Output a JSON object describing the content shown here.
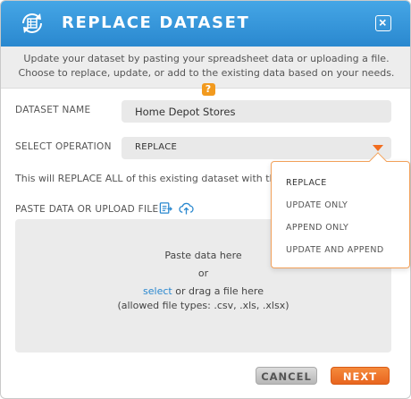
{
  "dialog": {
    "title": "REPLACE DATASET",
    "close_symbol": "✕",
    "intro_text": "Update your dataset by pasting your spreadsheet data or uploading a file. Choose to replace, update, or add to the existing data based on your needs.",
    "help_symbol": "?"
  },
  "form": {
    "dataset_name_label": "DATASET NAME",
    "dataset_name_value": "Home Depot Stores",
    "operation_label": "SELECT OPERATION",
    "operation_value": "REPLACE",
    "operation_note": "This will REPLACE ALL of this existing dataset with the n",
    "paste_label": "PASTE DATA OR UPLOAD FILE"
  },
  "dropzone": {
    "line1": "Paste data here",
    "line2": "or",
    "select_link": "select",
    "line3_rest": " or drag a file here",
    "line4": "(allowed file types: .csv, .xls, .xlsx)"
  },
  "buttons": {
    "cancel": "CANCEL",
    "next": "NEXT"
  },
  "dropdown": {
    "options": [
      "REPLACE",
      "UPDATE ONLY",
      "APPEND ONLY",
      "UPDATE AND APPEND"
    ]
  },
  "icons": {
    "title": "dataset-refresh-icon",
    "close": "close-icon",
    "help": "help-icon",
    "paste": "paste-data-icon",
    "upload": "cloud-upload-icon",
    "caret": "caret-down-icon"
  },
  "colors": {
    "header_blue": "#2a88cf",
    "accent_orange": "#f26d1f",
    "link_blue": "#2a88cf"
  }
}
